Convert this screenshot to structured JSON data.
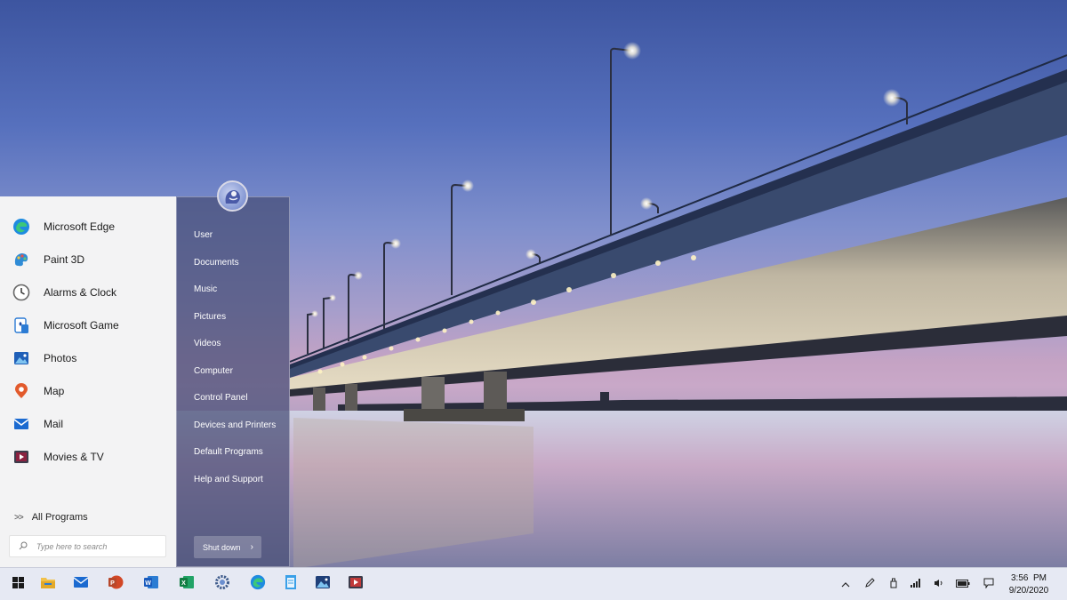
{
  "start_menu": {
    "apps": [
      {
        "label": "Microsoft Edge",
        "icon": "edge-icon"
      },
      {
        "label": "Paint 3D",
        "icon": "paint-3d-icon"
      },
      {
        "label": "Alarms & Clock",
        "icon": "alarm-clock-icon"
      },
      {
        "label": "Microsoft Game",
        "icon": "game-icon"
      },
      {
        "label": "Photos",
        "icon": "photos-icon"
      },
      {
        "label": "Map",
        "icon": "map-pin-icon"
      },
      {
        "label": "Mail",
        "icon": "mail-icon"
      },
      {
        "label": "Movies & TV",
        "icon": "movies-icon"
      }
    ],
    "all_programs_chevron": ">>",
    "all_programs_label": "All Programs",
    "search_placeholder": "Type here to search",
    "places": [
      "User",
      "Documents",
      "Music",
      "Pictures",
      "Videos",
      "Computer",
      "Control Panel",
      "Devices and Printers",
      "Default Programs",
      "Help and Support"
    ],
    "shutdown_label": "Shut down",
    "shutdown_arrow": "›"
  },
  "taskbar": {
    "pinned": [
      "windows-start-icon",
      "file-explorer-icon",
      "mail-icon",
      "powerpoint-icon",
      "word-icon",
      "excel-icon",
      "settings-gear-icon",
      "edge-icon",
      "notepad-icon",
      "photos-icon",
      "movies-icon"
    ],
    "tray": [
      "chevron-up-icon",
      "pen-icon",
      "usb-icon",
      "network-icon",
      "volume-icon",
      "battery-icon",
      "notification-icon"
    ],
    "time": "3:56  PM",
    "date": "9/20/2020"
  },
  "colors": {
    "accent": "#0078d4",
    "start_right_pane": "#464e76",
    "taskbar_bg": "#e6e9f3"
  }
}
